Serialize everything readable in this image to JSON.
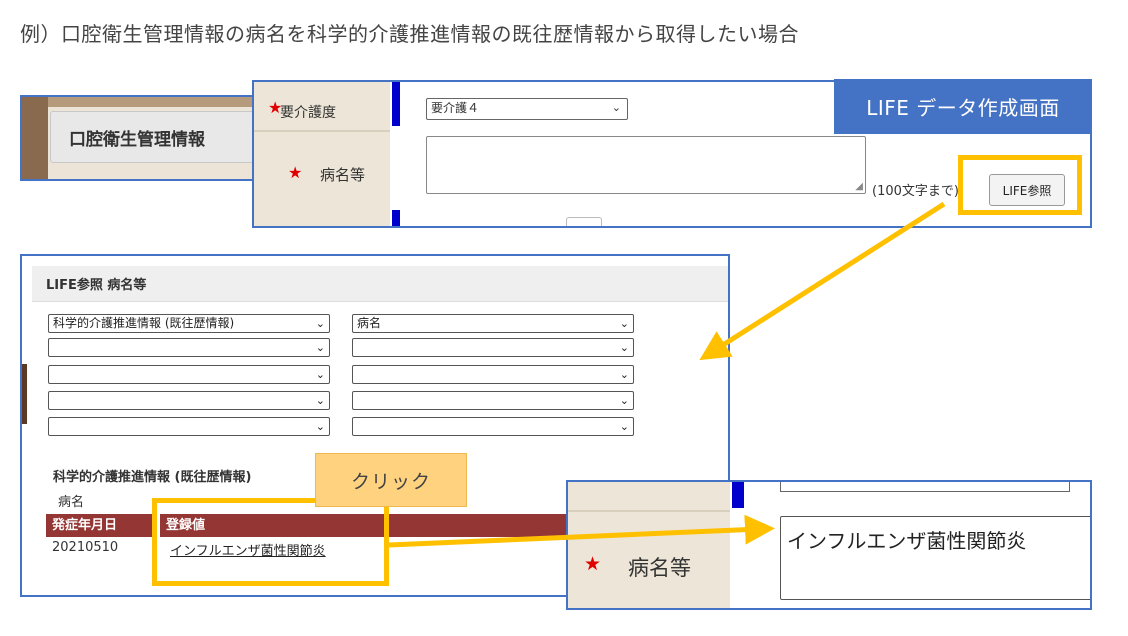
{
  "caption": "例）口腔衛生管理情報の病名を科学的介護推進情報の既往歴情報から取得したい場合",
  "tab_panel": {
    "button_label": "口腔衛生管理情報"
  },
  "form_panel": {
    "callout": "LIFE データ作成画面",
    "row1_label": "要介護度",
    "row1_select": "要介護４",
    "row2_label": "病名等",
    "hint": "(100文字まで)",
    "life_button": "LIFE参照"
  },
  "modal": {
    "title": "LIFE参照 病名等",
    "selects_left": [
      "科学的介護推進情報 (既往歴情報)",
      "",
      "",
      "",
      ""
    ],
    "selects_right": [
      "病名",
      "",
      "",
      "",
      ""
    ],
    "subtitle": "科学的介護推進情報 (既往歴情報)",
    "field": "病名",
    "columns": [
      "発症年月日",
      "登録値"
    ],
    "rows": [
      {
        "date": "20210510",
        "value": "インフルエンザ菌性関節炎"
      }
    ]
  },
  "click_callout": "クリック",
  "result_panel": {
    "label": "病名等",
    "value": "インフルエンザ菌性関節炎"
  },
  "colors": {
    "accent_blue": "#4472c4",
    "highlight": "#ffc000",
    "header_red": "#943634",
    "callout_orange": "#ffd27f"
  },
  "icons": {
    "required": "star-icon",
    "dropdown": "chevron-down-icon"
  }
}
